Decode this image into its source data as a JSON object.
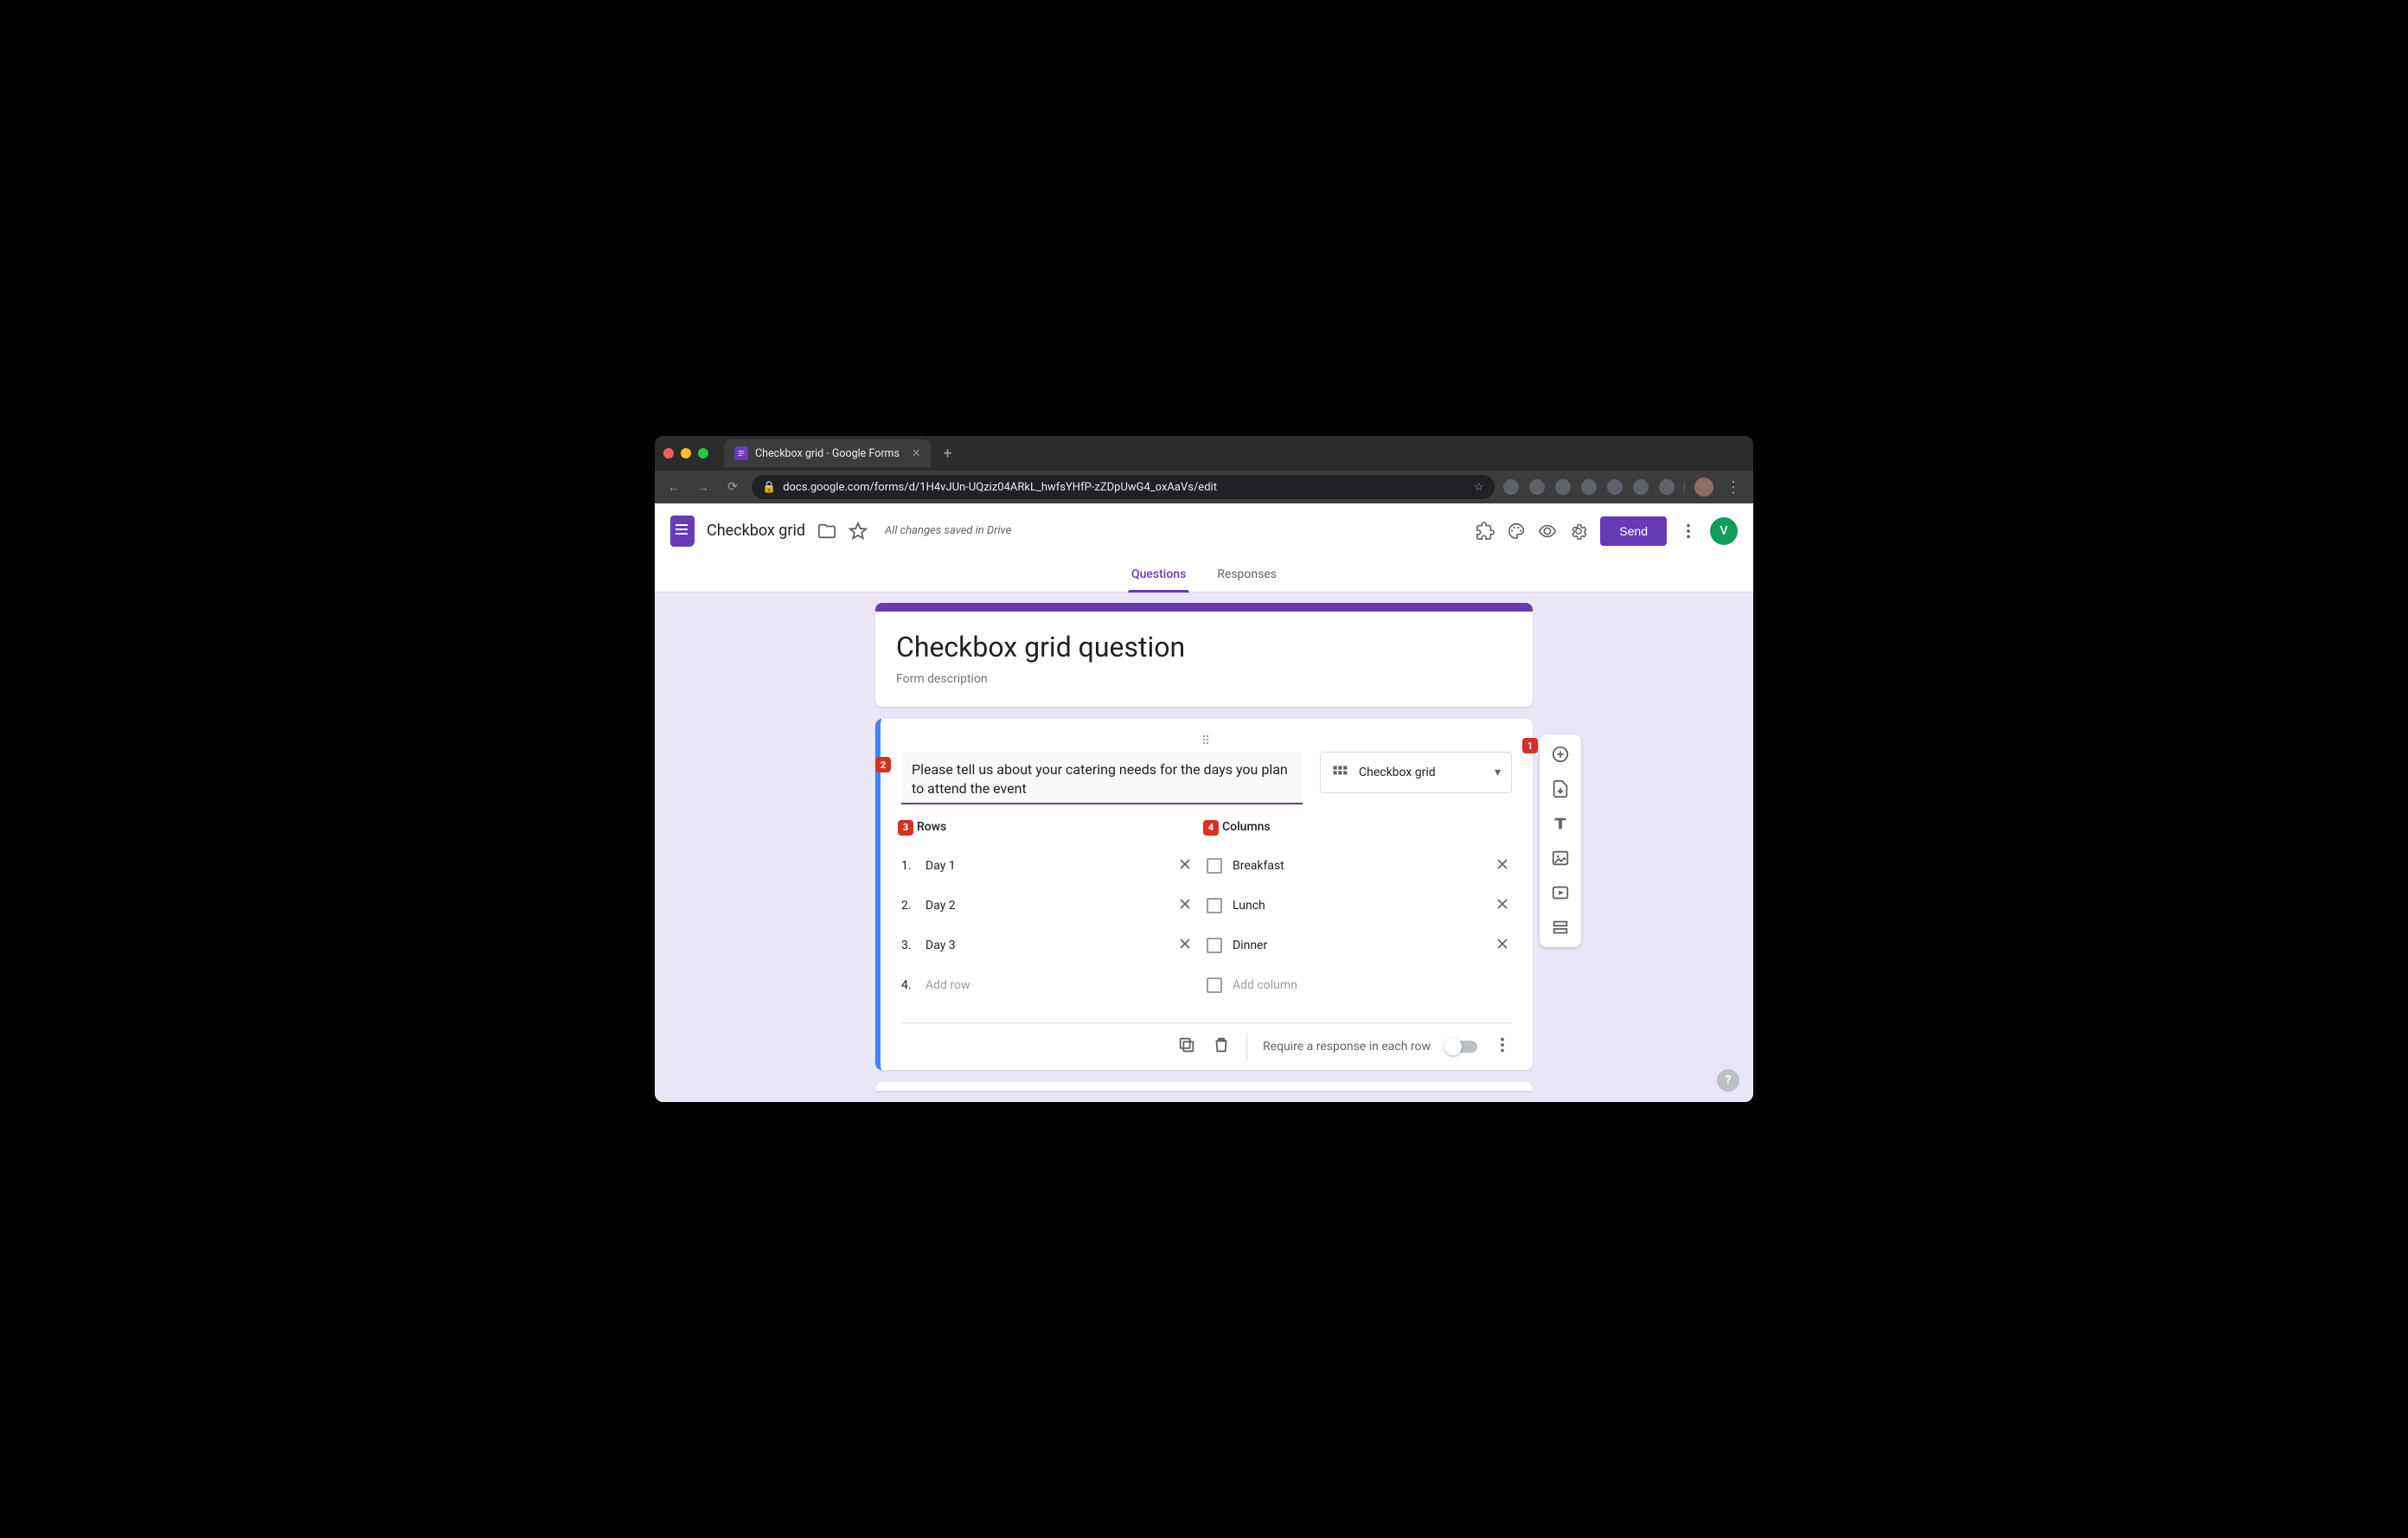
{
  "browser": {
    "tab_title": "Checkbox grid - Google Forms",
    "url": "docs.google.com/forms/d/1H4vJUn-UQziz04ARkL_hwfsYHfP-zZDpUwG4_oxAaVs/edit"
  },
  "header": {
    "doc_title": "Checkbox grid",
    "save_status": "All changes saved in Drive",
    "send_label": "Send",
    "avatar_letter": "V"
  },
  "tabs": {
    "questions": "Questions",
    "responses": "Responses"
  },
  "form": {
    "title": "Checkbox grid question",
    "description_placeholder": "Form description"
  },
  "question": {
    "text": "Please tell us about your catering needs for the days you plan to attend the event",
    "type_label": "Checkbox grid",
    "rows_label": "Rows",
    "columns_label": "Columns",
    "rows": [
      {
        "num": "1.",
        "label": "Day 1"
      },
      {
        "num": "2.",
        "label": "Day 2"
      },
      {
        "num": "3.",
        "label": "Day 3"
      }
    ],
    "row_placeholder_num": "4.",
    "row_placeholder": "Add row",
    "columns": [
      {
        "label": "Breakfast"
      },
      {
        "label": "Lunch"
      },
      {
        "label": "Dinner"
      }
    ],
    "column_placeholder": "Add column",
    "require_label": "Require a response in each row"
  },
  "badges": {
    "b1": "1",
    "b2": "2",
    "b3": "3",
    "b4": "4"
  }
}
